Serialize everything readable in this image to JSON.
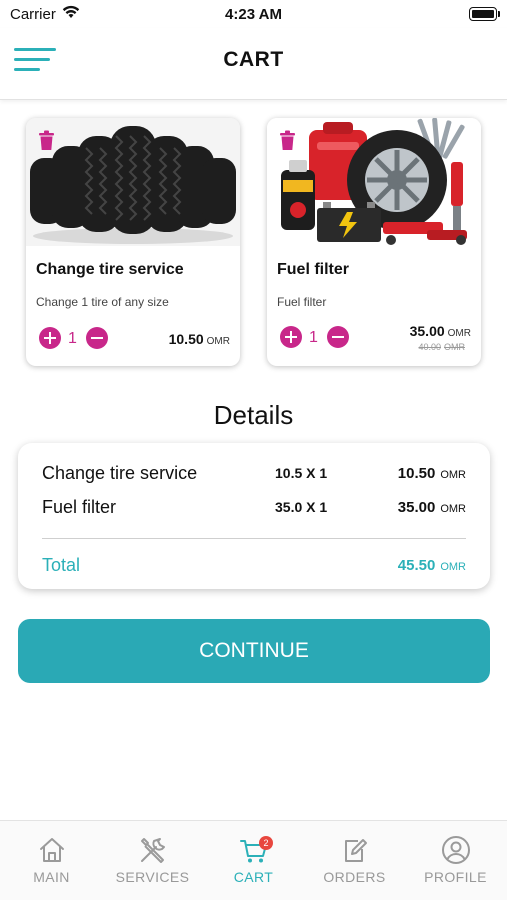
{
  "status_bar": {
    "carrier": "Carrier",
    "time": "4:23 AM"
  },
  "header": {
    "title": "CART",
    "menu_icon": "hamburger-menu-icon"
  },
  "cart_items": [
    {
      "name": "Change tire service",
      "description": "Change 1 tire of any size",
      "quantity": "1",
      "price": "10.50",
      "currency": "OMR",
      "image": "tires-image",
      "delete_icon": "trash-icon"
    },
    {
      "name": "Fuel filter",
      "description": "Fuel filter",
      "quantity": "1",
      "price": "35.00",
      "currency": "OMR",
      "old_price": "40.00",
      "old_currency": "OMR",
      "image": "car-parts-image",
      "delete_icon": "trash-icon"
    }
  ],
  "details": {
    "title": "Details",
    "rows": [
      {
        "name": "Change tire service",
        "qty": "10.5 X 1",
        "amount": "10.50",
        "currency": "OMR"
      },
      {
        "name": "Fuel filter",
        "qty": "35.0 X 1",
        "amount": "35.00",
        "currency": "OMR"
      }
    ],
    "total_label": "Total",
    "total_amount": "45.50",
    "total_currency": "OMR"
  },
  "continue_label": "CONTINUE",
  "tabs": [
    {
      "label": "MAIN",
      "icon": "home-icon",
      "active": false
    },
    {
      "label": "SERVICES",
      "icon": "tools-icon",
      "active": false
    },
    {
      "label": "CART",
      "icon": "cart-icon",
      "active": true,
      "badge": "2"
    },
    {
      "label": "ORDERS",
      "icon": "edit-icon",
      "active": false
    },
    {
      "label": "PROFILE",
      "icon": "user-icon",
      "active": false
    }
  ],
  "colors": {
    "accent": "#2bb0b8",
    "button": "#2aa9b5",
    "qty_control": "#c8278a",
    "badge": "#e8473e"
  }
}
